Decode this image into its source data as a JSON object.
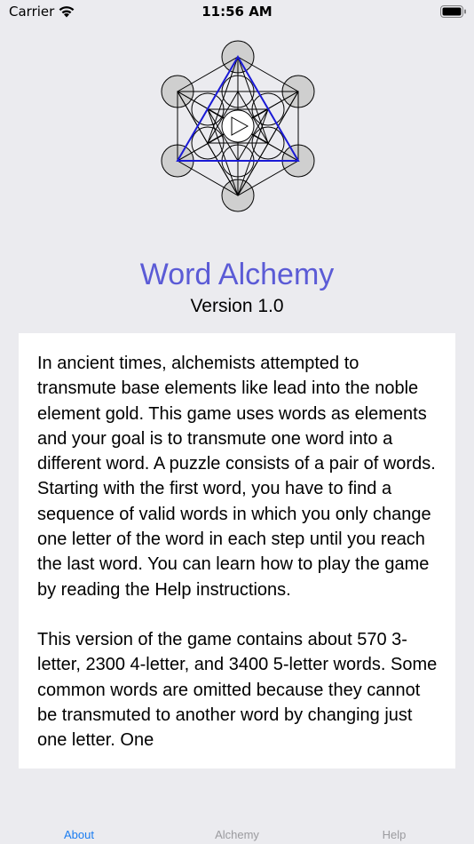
{
  "status_bar": {
    "carrier": "Carrier",
    "time": "11:56 AM"
  },
  "header": {
    "title": "Word Alchemy",
    "version": "Version 1.0"
  },
  "about": {
    "paragraphs": [
      "In ancient times, alchemists attempted to transmute base elements like lead into the noble element gold. This game uses words as elements and your goal is to transmute one word into a different word. A puzzle consists of a pair of words. Starting with the first word, you have to find a sequence of valid words in which you only change one letter of the word in each step until you reach the last word. You can learn how to play the game by reading the Help instructions.",
      "This version of the game contains about 570 3-letter, 2300 4-letter, and 3400 5-letter words. Some common words are omitted because they cannot be transmuted to another word by changing just one letter. One"
    ]
  },
  "tabs": [
    {
      "label": "About",
      "selected": true
    },
    {
      "label": "Alchemy",
      "selected": false
    },
    {
      "label": "Help",
      "selected": false
    }
  ],
  "colors": {
    "title": "#5b5bd6",
    "tab_active": "#1a7cf0",
    "tab_inactive": "#9b9b9f",
    "background": "#ebebef"
  }
}
